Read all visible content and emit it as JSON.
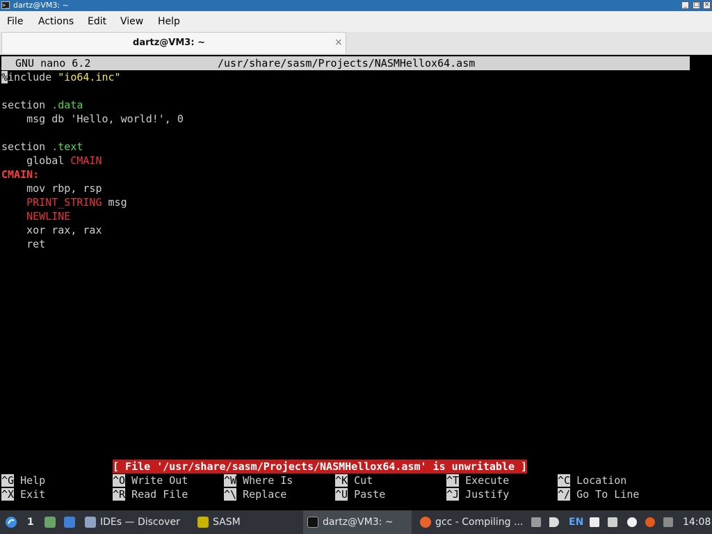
{
  "window": {
    "title": "dartz@VM3: ~",
    "icon": "terminal-icon",
    "buttons": [
      "minimize",
      "maximize",
      "close"
    ],
    "button_glyphs": [
      "_",
      "□",
      "×"
    ]
  },
  "menu": [
    "File",
    "Actions",
    "Edit",
    "View",
    "Help"
  ],
  "tab": {
    "label": "dartz@VM3: ~",
    "close": "×"
  },
  "nano": {
    "version": "GNU nano 6.2",
    "filepath": "/usr/share/sasm/Projects/NASMHellox64.asm"
  },
  "code": {
    "l1_a": "%",
    "l1_b": "include ",
    "l1_c": "\"io64.inc\"",
    "l3_a": "section ",
    "l3_b": ".data",
    "l4": "    msg db 'Hello, world!', 0",
    "l6_a": "section ",
    "l6_b": ".text",
    "l7_a": "    global ",
    "l7_b": "CMAIN",
    "l8": "CMAIN:",
    "l9": "    mov rbp, rsp",
    "l10_a": "    ",
    "l10_b": "PRINT_STRING",
    "l10_c": " msg",
    "l11_a": "    ",
    "l11_b": "NEWLINE",
    "l12": "    xor rax, rax",
    "l13": "    ret"
  },
  "status_message": "[ File '/usr/share/sasm/Projects/NASMHellox64.asm' is unwritable ]",
  "shortcuts": [
    {
      "key": "^G",
      "label": " Help"
    },
    {
      "key": "^O",
      "label": " Write Out"
    },
    {
      "key": "^W",
      "label": " Where Is"
    },
    {
      "key": "^K",
      "label": " Cut"
    },
    {
      "key": "^T",
      "label": " Execute"
    },
    {
      "key": "^C",
      "label": " Location"
    },
    {
      "key": "^X",
      "label": " Exit"
    },
    {
      "key": "^R",
      "label": " Read File"
    },
    {
      "key": "^\\",
      "label": " Replace"
    },
    {
      "key": "^U",
      "label": " Paste"
    },
    {
      "key": "^J",
      "label": " Justify"
    },
    {
      "key": "^/",
      "label": " Go To Line"
    }
  ],
  "taskbar": {
    "workspace": "1",
    "tasks": [
      {
        "label": "IDEs — Discover",
        "icon": "discover-icon"
      },
      {
        "label": "SASM",
        "icon": "sasm-icon"
      },
      {
        "label": "dartz@VM3: ~",
        "icon": "terminal-icon"
      },
      {
        "label": "gcc - Compiling ...",
        "icon": "firefox-icon"
      }
    ],
    "lang": "EN",
    "clock": "14:08"
  },
  "colors": {
    "titlebar": "#2a6fb0",
    "terminal_bg": "#000000",
    "nano_header": "#d3d3d3",
    "status_bg": "#c41c1c",
    "string": "#f2ea4a",
    "directive": "#56d64e",
    "macro": "#e8343b"
  }
}
